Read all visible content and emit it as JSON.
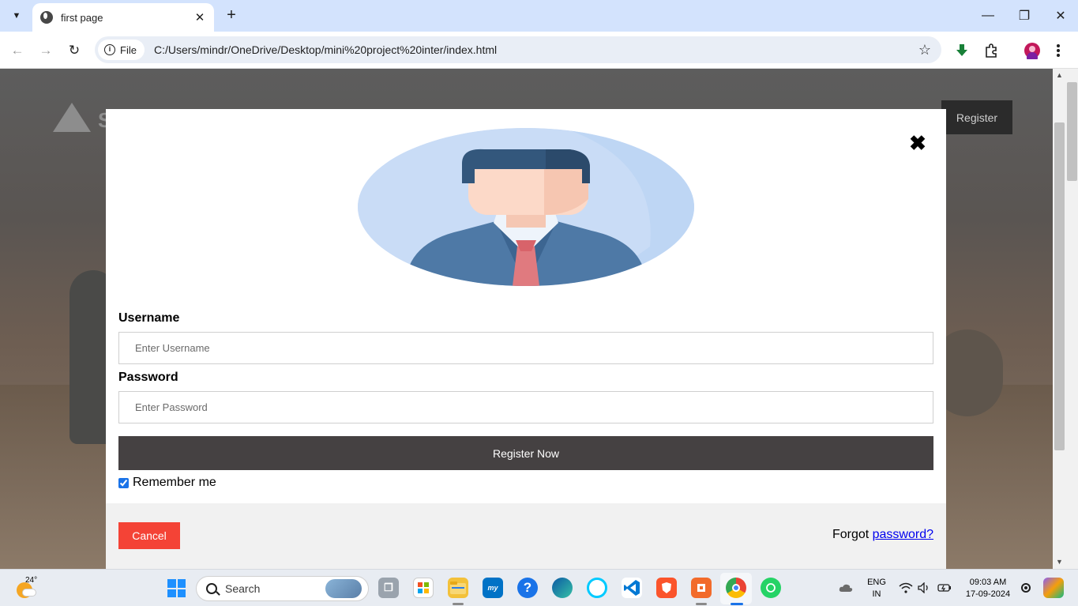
{
  "browser": {
    "tab_title": "first page",
    "chip_label": "File",
    "url": "C:/Users/mindr/OneDrive/Desktop/mini%20project%20inter/index.html"
  },
  "background_page": {
    "logo_letter": "S",
    "register_label": "Register"
  },
  "modal": {
    "close_symbol": "✖",
    "username_label": "Username",
    "username_placeholder": "Enter Username",
    "password_label": "Password",
    "password_placeholder": "Enter Password",
    "submit_label": "Register Now",
    "remember_label": "Remember me",
    "remember_checked": true,
    "cancel_label": "Cancel",
    "forgot_prefix": "Forgot ",
    "forgot_link": "password?",
    "colors": {
      "submit_bg": "#454142",
      "cancel_bg": "#f44336",
      "link": "#0000ee",
      "avatar_bg": "#c9dcf6"
    }
  },
  "taskbar": {
    "temperature": "24°",
    "search_placeholder": "Search",
    "apps": [
      "task-view",
      "store",
      "file-explorer",
      "myhp",
      "help",
      "edge",
      "alexa",
      "vscode",
      "brave",
      "app-orange",
      "chrome",
      "whatsapp"
    ],
    "lang_top": "ENG",
    "lang_bottom": "IN",
    "time": "09:03 AM",
    "date": "17-09-2024"
  }
}
